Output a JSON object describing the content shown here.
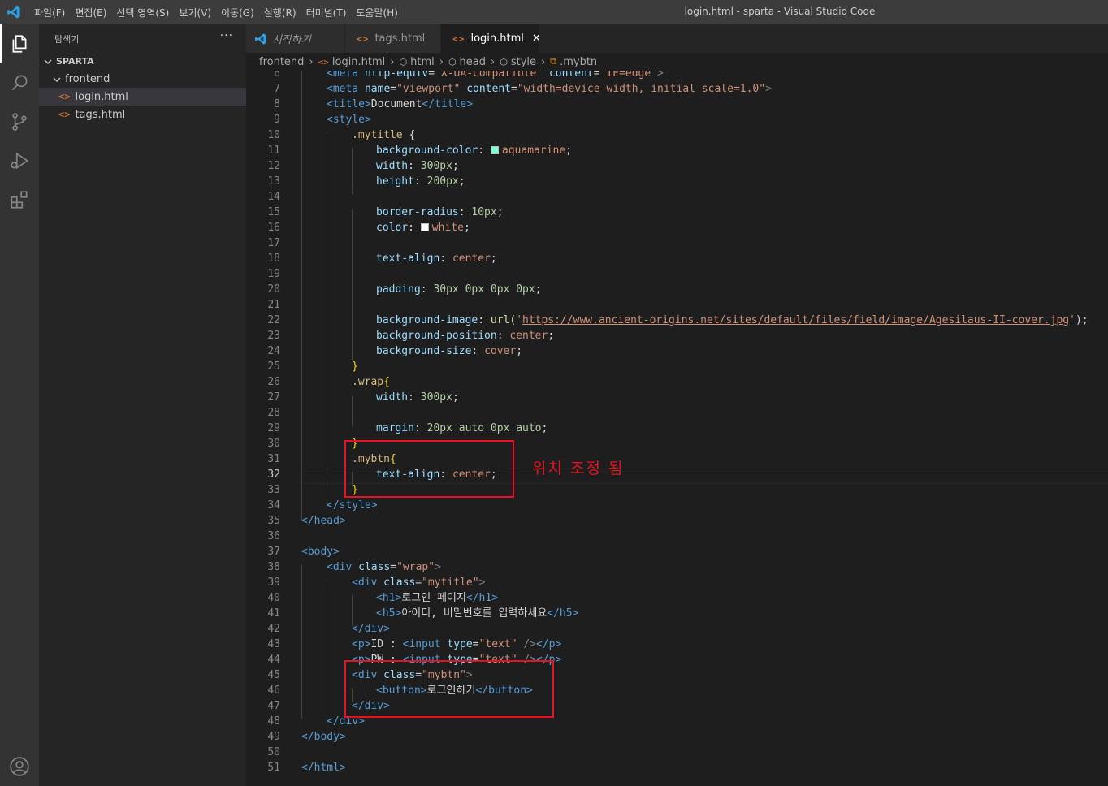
{
  "titlebar": {
    "menu": [
      "파일(F)",
      "편집(E)",
      "선택 영역(S)",
      "보기(V)",
      "이동(G)",
      "실행(R)",
      "터미널(T)",
      "도움말(H)"
    ],
    "window_title": "login.html - sparta - Visual Studio Code"
  },
  "sidebar": {
    "title": "탐색기",
    "more": "···",
    "root": "SPARTA",
    "folder": "frontend",
    "files": [
      "login.html",
      "tags.html"
    ]
  },
  "tabs": [
    {
      "label": "시작하기"
    },
    {
      "label": "tags.html"
    },
    {
      "label": "login.html",
      "close": "✕"
    }
  ],
  "breadcrumb": [
    "frontend",
    "login.html",
    "html",
    "head",
    "style",
    ".mybtn"
  ],
  "editor": {
    "line_numbers": [
      "6",
      "7",
      "8",
      "9",
      "10",
      "11",
      "12",
      "13",
      "14",
      "15",
      "16",
      "17",
      "18",
      "19",
      "20",
      "21",
      "22",
      "23",
      "24",
      "25",
      "26",
      "27",
      "28",
      "29",
      "30",
      "31",
      "32",
      "33",
      "34",
      "35",
      "36",
      "37",
      "38",
      "39",
      "40",
      "41",
      "42",
      "43",
      "44",
      "45",
      "46",
      "47",
      "48",
      "49",
      "50",
      "51"
    ],
    "current_line": "32",
    "code": {
      "l6": {
        "a": "<meta ",
        "b": "http-equiv",
        "c": "=",
        "d": "\"X-UA-Compatible\"",
        "e": " content",
        "f": "=",
        "g": "\"IE=edge\"",
        "h": ">"
      },
      "l7": {
        "a": "<meta ",
        "b": "name",
        "c": "=",
        "d": "\"viewport\"",
        "e": " content",
        "f": "=",
        "g": "\"width=device-width, initial-scale=1.0\"",
        "h": ">"
      },
      "l8": {
        "a": "<title>",
        "b": "Document",
        "c": "</title>"
      },
      "l9": {
        "a": "<style>"
      },
      "l10": {
        "a": ".mytitle",
        "b": " {"
      },
      "l11": {
        "a": "background-color",
        "b": ": ",
        "c": "aquamarine",
        "d": ";"
      },
      "l12": {
        "a": "width",
        "b": ": ",
        "c": "300px",
        "d": ";"
      },
      "l13": {
        "a": "height",
        "b": ": ",
        "c": "200px",
        "d": ";"
      },
      "l15": {
        "a": "border-radius",
        "b": ": ",
        "c": "10px",
        "d": ";"
      },
      "l16": {
        "a": "color",
        "b": ": ",
        "c": "white",
        "d": ";"
      },
      "l18": {
        "a": "text-align",
        "b": ": ",
        "c": "center",
        "d": ";"
      },
      "l20": {
        "a": "padding",
        "b": ": ",
        "c": "30px 0px 0px 0px",
        "d": ";"
      },
      "l22": {
        "a": "background-image",
        "b": ": ",
        "c": "url(",
        "d": "'",
        "e": "https://www.ancient-origins.net/sites/default/files/field/image/Agesilaus-II-cover.jpg",
        "f": "'",
        "g": ");"
      },
      "l23": {
        "a": "background-position",
        "b": ": ",
        "c": "center",
        "d": ";"
      },
      "l24": {
        "a": "background-size",
        "b": ": ",
        "c": "cover",
        "d": ";"
      },
      "l25": {
        "a": "}"
      },
      "l26": {
        "a": ".wrap",
        "b": "{"
      },
      "l27": {
        "a": "width",
        "b": ": ",
        "c": "300px",
        "d": ";"
      },
      "l29": {
        "a": "margin",
        "b": ": ",
        "c": "20px auto 0px auto",
        "d": ";"
      },
      "l30": {
        "a": "}"
      },
      "l31": {
        "a": ".mybtn",
        "b": "{"
      },
      "l32": {
        "a": "text-align",
        "b": ": ",
        "c": "center",
        "d": ";"
      },
      "l33": {
        "a": "}"
      },
      "l34": {
        "a": "</style>"
      },
      "l35": {
        "a": "</head>"
      },
      "l37": {
        "a": "<body>"
      },
      "l38": {
        "a": "<div ",
        "b": "class",
        "c": "=",
        "d": "\"wrap\"",
        "e": ">"
      },
      "l39": {
        "a": "<div ",
        "b": "class",
        "c": "=",
        "d": "\"mytitle\"",
        "e": ">"
      },
      "l40": {
        "a": "<h1>",
        "b": "로그인 페이지",
        "c": "</h1>"
      },
      "l41": {
        "a": "<h5>",
        "b": "아이디, 비밀번호를 입력하세요",
        "c": "</h5>"
      },
      "l42": {
        "a": "</div>"
      },
      "l43": {
        "a": "<p>",
        "b": "ID : ",
        "c": "<input ",
        "d": "type",
        "e": "=",
        "f": "\"text\"",
        "g": " />",
        "h": "</p>"
      },
      "l44": {
        "a": "<p>",
        "b": "PW : ",
        "c": "<input ",
        "d": "type",
        "e": "=",
        "f": "\"text\"",
        "g": " />",
        "h": "</p>"
      },
      "l45": {
        "a": "<div ",
        "b": "class",
        "c": "=",
        "d": "\"mybtn\"",
        "e": ">"
      },
      "l46": {
        "a": "<button>",
        "b": "로그인하기",
        "c": "</button>"
      },
      "l47": {
        "a": "</div>"
      },
      "l48": {
        "a": "</div>"
      },
      "l49": {
        "a": "</body>"
      },
      "l51": {
        "a": "</html>"
      }
    }
  },
  "annotation": {
    "text": "위치 조정 됨",
    "color": "#e81123"
  },
  "colors": {
    "aquamarine": "#7fffd4",
    "white": "#ffffff"
  }
}
